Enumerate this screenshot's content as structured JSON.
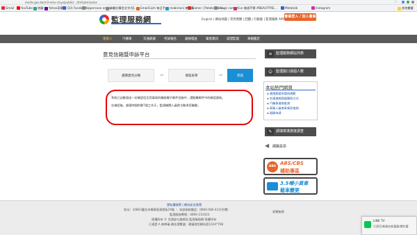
{
  "browser": {
    "url": "mvdis.gov.tw/m3-emv-c/sys/public/.../tmSubmission",
    "bookmarks": [
      {
        "label": "Gmail",
        "color": "#d33"
      },
      {
        "label": "YouTube",
        "color": "#f00"
      },
      {
        "label": "地圖",
        "color": "#2a8"
      },
      {
        "label": "Yahoo奇摩",
        "color": "#609"
      },
      {
        "label": "(10) Facebook",
        "color": "#36c"
      },
      {
        "label": "Uppercase and Lo...",
        "color": "#888"
      },
      {
        "label": "計數計算型文字/訊...",
        "color": "#888"
      },
      {
        "label": "EmailCash 每日手...",
        "color": "#e60"
      },
      {
        "label": "mobimoni 麥麥客",
        "color": "#29c"
      },
      {
        "label": "Gamer | Potato Media",
        "color": "#c33"
      },
      {
        "label": "Image caman",
        "color": "#888"
      },
      {
        "label": "Fun 幾週不需 #BEAUTYRE...",
        "color": "#c36"
      },
      {
        "label": "Metatalk",
        "color": "#36c"
      },
      {
        "label": "Instagram",
        "color": "#c3a"
      },
      {
        "label": "其他書籤",
        "color": "#fc3"
      }
    ]
  },
  "header": {
    "logo_text": "監理服務網",
    "util_links": "English | 網站地圖 | 常見問題 | 回饋 | 行動版 | 監理服務 APP",
    "cta_label": "會員登入 / 加入會員"
  },
  "nav": {
    "items": [
      "電駕人",
      "汽機車",
      "交通罰鍰",
      "考試報名",
      "違規稽查",
      "業者資訊",
      "認證監理",
      "車籍鑑定"
    ]
  },
  "page": {
    "title": "意見信箱暨申訴平台",
    "steps": [
      "選擇意見分類",
      "填寫表單",
      "完成"
    ],
    "step_arrow": "⇨",
    "message_p1": "系統已自動發送一封確認信至您填寫的聯絡電子郵件信箱中，請點擊郵件中的確認連結。",
    "message_p2": "在確認後，處理時間約需7個工作天，監理機關人員將主動與您聯繫。"
  },
  "sidebar": {
    "top_links": [
      {
        "label": "監理服務網站列表",
        "icon": "list-icon"
      },
      {
        "label": "監理窗口尋個人數",
        "icon": "person-icon"
      }
    ],
    "hot_title": "本站熱門網頁",
    "hot_links": [
      "違規罰鍰申請與規範",
      "交通違規罰鍰匯款方式",
      "汽機車違規查詢",
      "車駕人員來車資訊查詢",
      "號碼申請"
    ],
    "mid_links": [
      {
        "label": "請填寫滿意度調查",
        "icon": "survey-icon"
      }
    ],
    "vote_label": "網路投票",
    "banners": [
      {
        "line1": "ABS/CBS",
        "line2": "補助專區",
        "icon_text": "ABS"
      },
      {
        "line1": "3.5噸小貨車",
        "line2": "截車變更",
        "icon_text": ""
      }
    ]
  },
  "footer": {
    "line1": "隱私權政策 | 網站安全政策",
    "line2": "地址：10863臺北市萬華區東園街19號  ｜  本部服務電話：0800-080-412(付費)",
    "line3": "監理服務專線：0800-231023",
    "line4": "版權所有 © 交通部公路總局 監理服務網 版權所有",
    "line5": "已通過 A 無障礙 最佳瀏覽器：建議使用解析度1024*768",
    "badge_label": "易覽無障"
  },
  "toast": {
    "app": "LINE TV",
    "text": "大發豆/新劇名新喜劇/搶先看"
  }
}
